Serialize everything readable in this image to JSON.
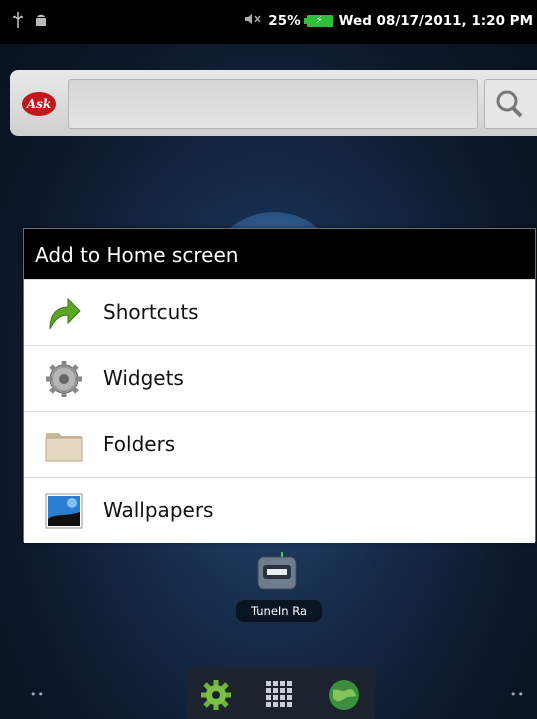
{
  "status_bar": {
    "left_icons": [
      "usb-icon",
      "android-debug-icon"
    ],
    "volume_icon": "mute-icon",
    "battery_percent": "25%",
    "battery_icon": "battery-charging-icon",
    "datetime": "Wed 08/17/2011, 1:20 PM"
  },
  "search_widget": {
    "logo_text": "Ask",
    "search_icon": "search-icon",
    "query": ""
  },
  "dialog": {
    "title": "Add to Home screen",
    "items": [
      {
        "label": "Shortcuts",
        "icon": "shortcut-arrow-icon"
      },
      {
        "label": "Widgets",
        "icon": "gear-icon"
      },
      {
        "label": "Folders",
        "icon": "folder-icon"
      },
      {
        "label": "Wallpapers",
        "icon": "wallpaper-icon"
      }
    ]
  },
  "desktop_apps": [
    {
      "label": "TuneIn Ra",
      "icon": "radio-icon"
    }
  ],
  "dock": {
    "items": [
      "settings-gear-icon",
      "app-drawer-grid-icon",
      "browser-globe-icon"
    ]
  },
  "page_indicators": {
    "left": "••",
    "right": "••"
  },
  "colors": {
    "accent_green": "#2fbf3a",
    "dialog_title_bg": "#000000",
    "dialog_bg": "#ffffff",
    "ask_red": "#c0181d"
  }
}
